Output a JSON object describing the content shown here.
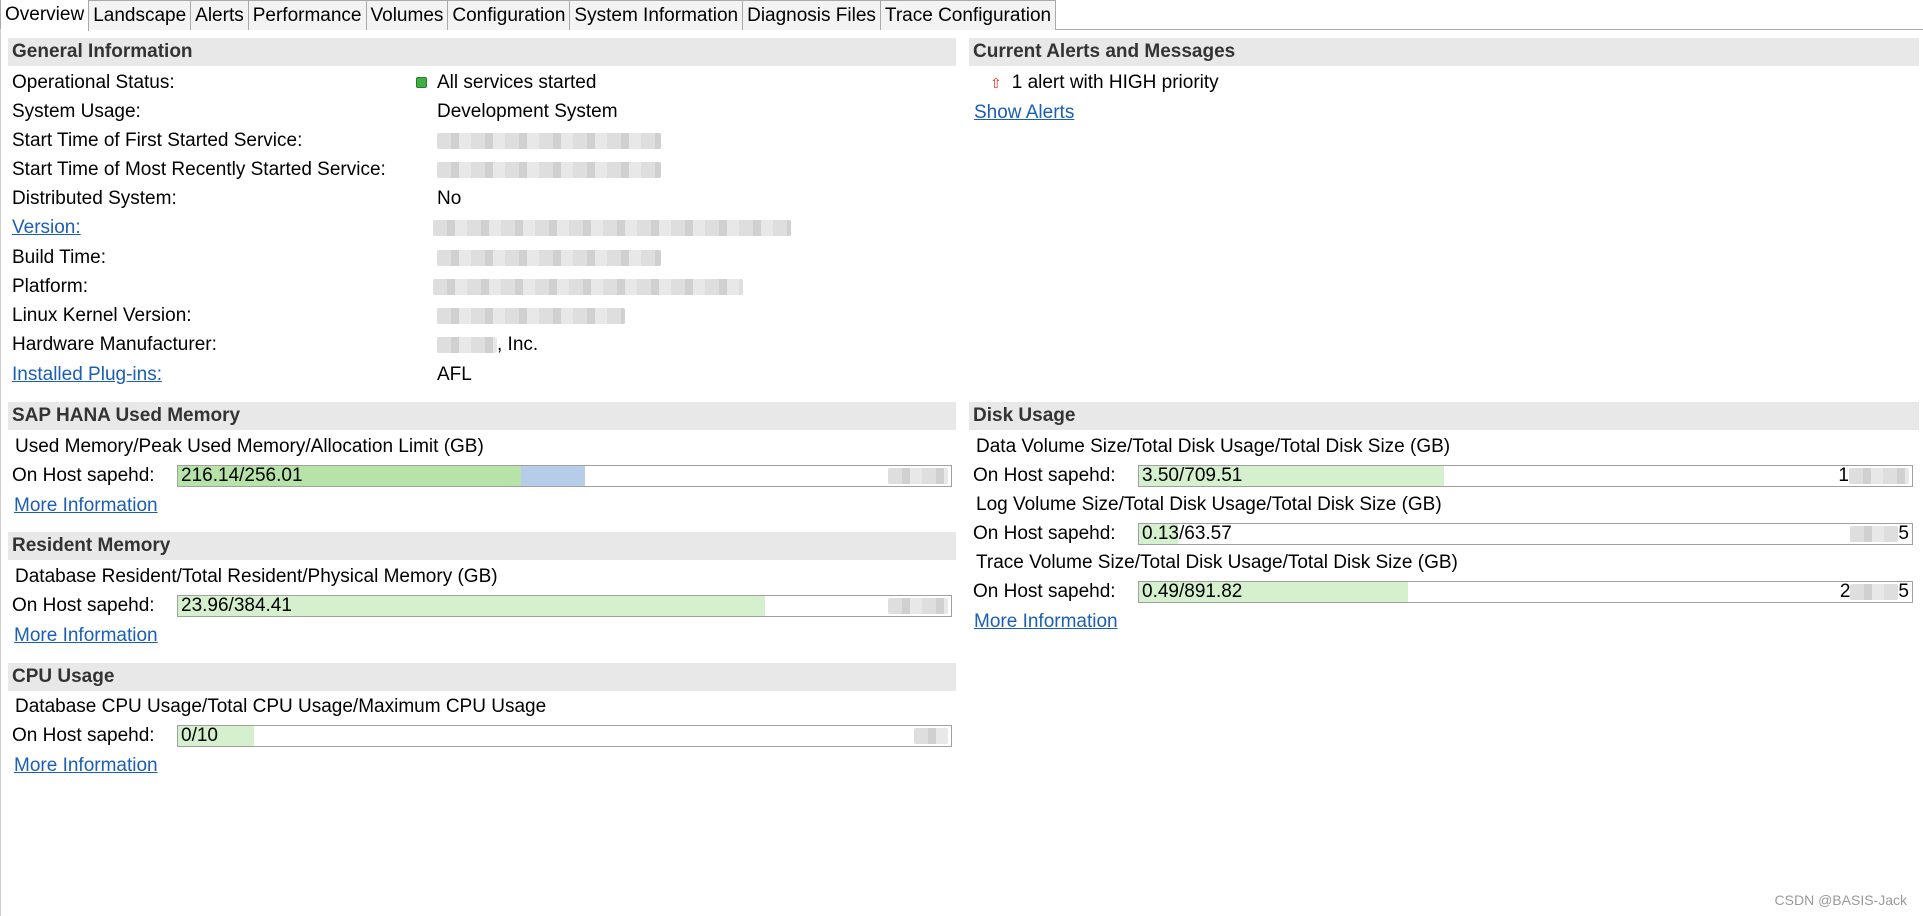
{
  "tabs": [
    "Overview",
    "Landscape",
    "Alerts",
    "Performance",
    "Volumes",
    "Configuration",
    "System Information",
    "Diagnosis Files",
    "Trace Configuration"
  ],
  "general": {
    "title": "General Information",
    "operational_status_label": "Operational Status:",
    "operational_status_value": "All services started",
    "system_usage_label": "System Usage:",
    "system_usage_value": "Development System",
    "start_first_label": "Start Time of First Started Service:",
    "start_recent_label": "Start Time of Most Recently Started Service:",
    "distributed_label": "Distributed System:",
    "distributed_value": "No",
    "version_label": "Version:",
    "build_time_label": "Build Time:",
    "platform_label": "Platform:",
    "kernel_label": "Linux Kernel Version:",
    "hw_label": "Hardware Manufacturer:",
    "hw_value_suffix": ", Inc.",
    "plugins_label": "Installed Plug-ins:",
    "plugins_value": "AFL"
  },
  "alerts": {
    "title": "Current Alerts and Messages",
    "message": "1 alert with HIGH priority",
    "show_link": "Show Alerts"
  },
  "memory": {
    "title": "SAP HANA Used Memory",
    "subtitle": "Used Memory/Peak Used Memory/Allocation Limit (GB)",
    "host_label": "On Host sapehd:",
    "value_text": "216.14/256.01",
    "used_fraction": 0.4443,
    "peak_fraction": 0.5262,
    "more": "More Information"
  },
  "resident": {
    "title": "Resident Memory",
    "subtitle": "Database Resident/Total Resident/Physical Memory (GB)",
    "host_label": "On Host sapehd:",
    "value_text": "23.96/384.41",
    "fill_fraction": 0.76,
    "more": "More Information"
  },
  "cpu": {
    "title": "CPU Usage",
    "subtitle": "Database CPU Usage/Total CPU Usage/Maximum CPU Usage",
    "host_label": "On Host sapehd:",
    "value_text": "0/10",
    "fill_fraction": 0.098,
    "more": "More Information"
  },
  "disk": {
    "title": "Disk Usage",
    "data_subtitle": "Data Volume Size/Total Disk Usage/Total Disk Size (GB)",
    "data_host": "On Host sapehd:",
    "data_value": "3.50/709.51",
    "data_end": "1",
    "data_fraction": 0.394,
    "log_subtitle": "Log Volume Size/Total Disk Usage/Total Disk Size (GB)",
    "log_host": "On Host sapehd:",
    "log_value": "0.13/63.57",
    "log_end": "5",
    "log_fraction": 0.05,
    "trace_subtitle": "Trace Volume Size/Total Disk Usage/Total Disk Size (GB)",
    "trace_host": "On Host sapehd:",
    "trace_value": "0.49/891.82",
    "trace_end_a": "2",
    "trace_end_b": "5",
    "trace_fraction": 0.348,
    "more": "More Information"
  },
  "watermark": "CSDN @BASIS-Jack",
  "colors": {
    "fill_green": "#b5e3a8",
    "fill_light_green": "#d4f0cc",
    "fill_blue": "#b5cde8",
    "section_bg": "#e8e8e8",
    "link": "#1a5fb4"
  }
}
